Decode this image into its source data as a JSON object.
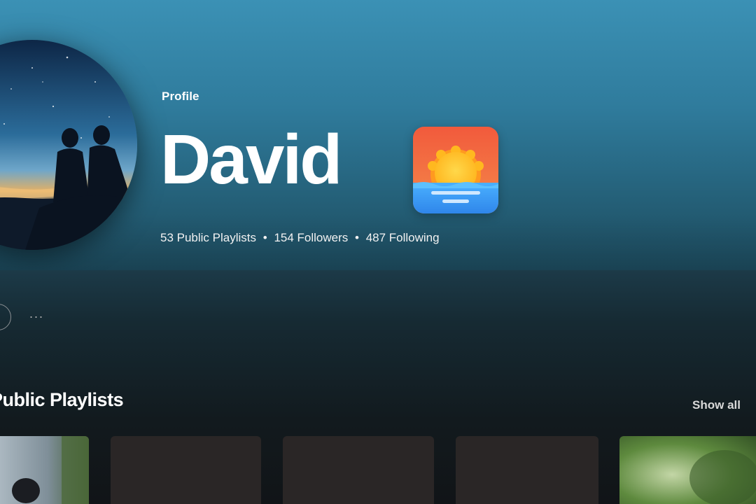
{
  "profile": {
    "type_label": "Profile",
    "name": "David",
    "stats": {
      "playlists": "53 Public Playlists",
      "followers": "154 Followers",
      "following": "487 Following",
      "separator": "•"
    }
  },
  "actions": {
    "more_label": "···"
  },
  "section": {
    "title": "Public Playlists",
    "show_all_label": "Show all"
  },
  "cards": [
    {
      "kind": "photo-person"
    },
    {
      "kind": "blank"
    },
    {
      "kind": "blank"
    },
    {
      "kind": "blank"
    },
    {
      "kind": "photo-green"
    }
  ],
  "colors": {
    "hero_top": "#3b91b5",
    "hero_bottom": "#1d4b5e",
    "page_bg": "#121212",
    "card_bg": "#2a2626",
    "badge_sky": "#f0623f",
    "badge_sun": "#ffc629",
    "badge_sea": "#3fa1f5"
  }
}
